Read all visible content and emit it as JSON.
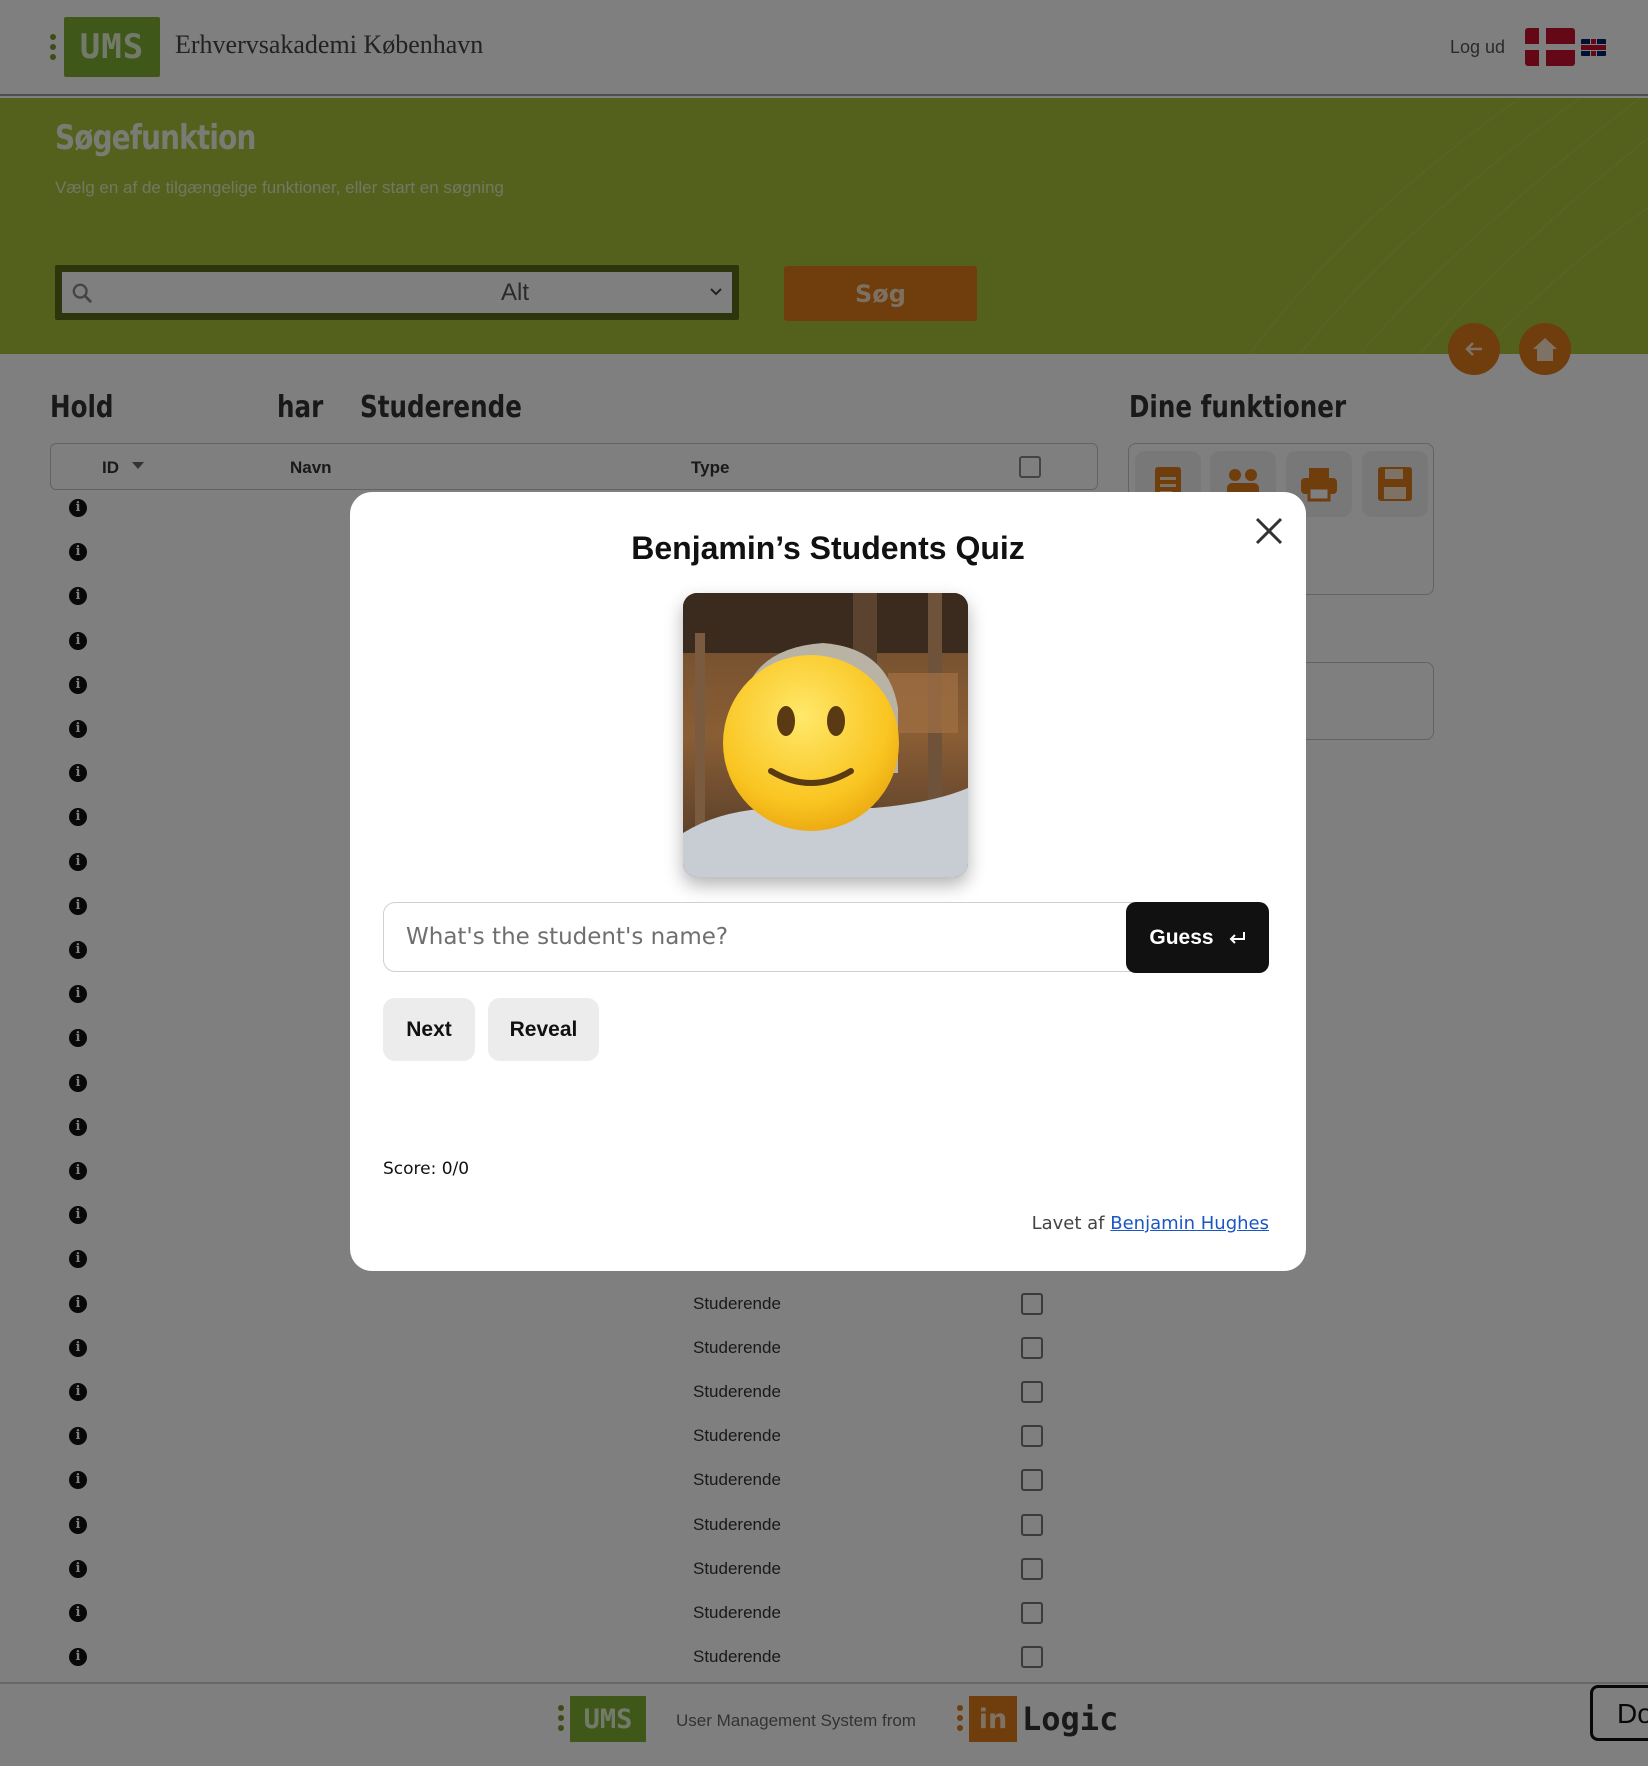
{
  "header": {
    "logo_text": "UMS",
    "org_name": "Erhvervsakademi København",
    "logout_label": "Log ud",
    "flags": [
      "flag-dk-icon",
      "flag-uk-icon"
    ]
  },
  "search_band": {
    "title": "Søgefunktion",
    "subtitle": "Vælg en af de tilgængelige funktioner, eller start en søgning",
    "search_value": "",
    "scope_selected": "Alt",
    "search_button": "Søg",
    "icons": [
      "search-icon",
      "back-arrow-icon",
      "home-icon"
    ]
  },
  "content": {
    "title_left": "Hold",
    "title_mid": "har",
    "title_right": "Studerende",
    "functions_title": "Dine funktioner",
    "columns": {
      "id": "ID",
      "name": "Navn",
      "type": "Type"
    },
    "visible_type_rows": [
      "Studerende",
      "Studerende",
      "Studerende",
      "Studerende",
      "Studerende",
      "Studerende",
      "Studerende",
      "Studerende",
      "Studerende"
    ],
    "function_icons": [
      "document-icon",
      "group-icon",
      "printer-icon",
      "save-icon"
    ]
  },
  "quiz": {
    "title": "Benjamin’s Students Quiz",
    "input_placeholder": "What's the student's name?",
    "input_value": "",
    "guess_label": "Guess",
    "next_label": "Next",
    "reveal_label": "Reveal",
    "score_text": "Score: 0/0",
    "credit_prefix": "Lavet af",
    "credit_name": "Benjamin Hughes"
  },
  "footer": {
    "ums_text": "UMS",
    "tagline": "User Management System from",
    "in_text": "in",
    "logic_text": "Logic",
    "corner_button": "Do"
  },
  "colors": {
    "brand_green": "#7fb035",
    "band_green": "#a7c23b",
    "accent_orange": "#e07a1a",
    "guess_button": "#111111",
    "link_blue": "#1a56c4"
  }
}
